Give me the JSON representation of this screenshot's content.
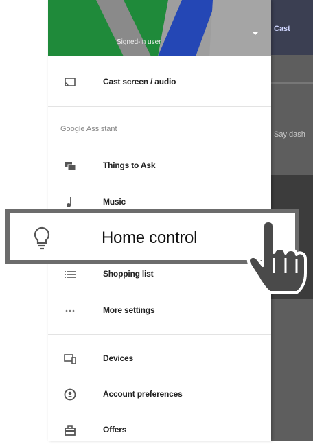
{
  "header": {
    "account_name": "Signed-in user"
  },
  "menu": {
    "cast_label": "Cast screen / audio",
    "section_label": "Google Assistant",
    "things_label": "Things to Ask",
    "music_label": "Music",
    "home_control_label": "Home control",
    "shopping_label": "Shopping list",
    "more_settings_label": "More settings",
    "devices_label": "Devices",
    "account_prefs_label": "Account preferences",
    "offers_label": "Offers"
  },
  "background": {
    "text_1": "Cast",
    "text_2": "Say dash"
  },
  "colors": {
    "header_green": "#1f8a3a",
    "header_blue": "#2447b5",
    "header_grey": "#9e9e9e",
    "highlight_border": "#6c6c6c"
  }
}
